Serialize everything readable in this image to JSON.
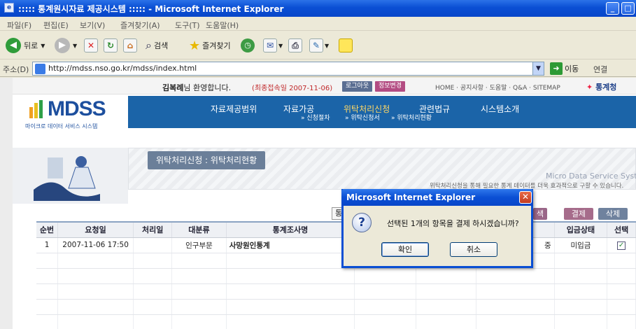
{
  "window": {
    "title": "::::: 통계원시자료 제공시스템 ::::: - Microsoft Internet Explorer",
    "icon": "ie-page-icon"
  },
  "menu": [
    "파일(F)",
    "편집(E)",
    "보기(V)",
    "즐겨찾기(A)",
    "도구(T)",
    "도움말(H)"
  ],
  "toolbar": {
    "back": "뒤로",
    "search": "검색",
    "favorites": "즐겨찾기"
  },
  "address": {
    "label": "주소(D)",
    "url": "http://mdss.nso.go.kr/mdss/index.html",
    "go": "이동",
    "links": "연결"
  },
  "site": {
    "welcome_name": "김복례",
    "welcome_suffix": "님 환영합니다.",
    "last_login": "(최종접속일 2007-11-06)",
    "logout": "로그아웃",
    "info_change": "정보변경",
    "top_links": "HOME · 공지사항 · 도움말 · Q&A · SITEMAP",
    "brand": "통계청",
    "logo": "MDSS",
    "logo_sub": "마이크로 데이터 서비스 시스템",
    "nav": [
      "자료제공범위",
      "자료가공",
      "위탁처리신청",
      "관련법규",
      "시스템소개"
    ],
    "subnav": [
      "» 신청절차",
      "» 위탁신청서",
      "» 위탁처리현황"
    ],
    "section_title": "위탁처리신청 : 위탁처리현황",
    "banner_en": "Micro Data Service System",
    "banner_desc": "위탁처리신청을 통해 필요한 통계 데이터를 더욱 효과적으로 구할 수 있습니다.",
    "btn_tong": "통",
    "btn_search_partial": "색",
    "btn_pay": "결제",
    "btn_delete": "삭제"
  },
  "table": {
    "headers": [
      "순번",
      "요청일",
      "처리일",
      "대분류",
      "통계조사명",
      "",
      "",
      "",
      "입금상태",
      "선택"
    ],
    "rows": [
      {
        "no": "1",
        "req_date": "2007-11-06 17:50",
        "proc_date": "",
        "category": "인구부문",
        "survey": "사망원인통계",
        "status_partial": "중",
        "payment": "미입금",
        "checked": "✓"
      }
    ]
  },
  "dialog": {
    "title": "Microsoft Internet Explorer",
    "message": "선택된 1개의 항목을 결제 하시겠습니까?",
    "ok": "확인",
    "cancel": "취소"
  }
}
